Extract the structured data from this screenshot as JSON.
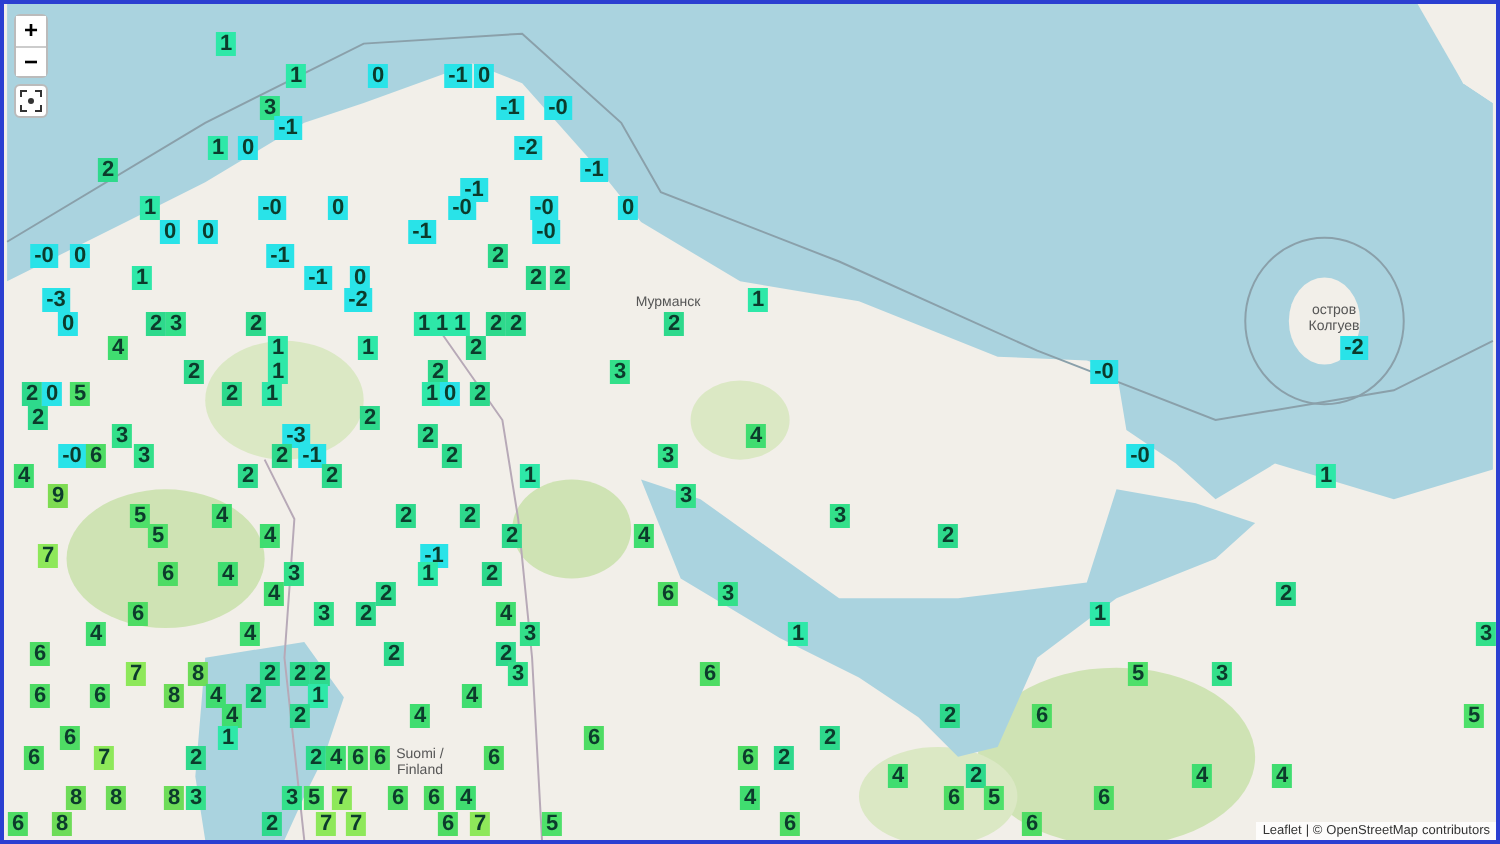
{
  "map": {
    "controls": {
      "zoom_in": "+",
      "zoom_out": "−"
    },
    "place_labels": [
      "Мурманск",
      "остров Колгуев",
      "Suomi / Finland"
    ],
    "markers": [
      {
        "value": "1",
        "color": "#2ee8a8"
      },
      {
        "value": "1",
        "color": "#2ee8a8"
      },
      {
        "value": "0",
        "color": "#29e3e8"
      },
      {
        "value": "-1",
        "color": "#29e3e8"
      },
      {
        "value": "0",
        "color": "#29e3e8"
      },
      {
        "value": "3",
        "color": "#33e08a"
      },
      {
        "value": "-1",
        "color": "#29e3e8"
      },
      {
        "value": "-0",
        "color": "#29e3e8"
      },
      {
        "value": "-1",
        "color": "#29e3e8"
      },
      {
        "value": "1",
        "color": "#2ee8a8"
      },
      {
        "value": "0",
        "color": "#29e3e8"
      },
      {
        "value": "-2",
        "color": "#29e3e8"
      },
      {
        "value": "2",
        "color": "#2ed98c"
      },
      {
        "value": "-1",
        "color": "#29e3e8"
      },
      {
        "value": "-1",
        "color": "#29e3e8"
      },
      {
        "value": "1",
        "color": "#2ee8a8"
      },
      {
        "value": "-0",
        "color": "#29e3e8"
      },
      {
        "value": "0",
        "color": "#29e3e8"
      },
      {
        "value": "-0",
        "color": "#29e3e8"
      },
      {
        "value": "-0",
        "color": "#29e3e8"
      },
      {
        "value": "0",
        "color": "#29e3e8"
      },
      {
        "value": "0",
        "color": "#29e3e8"
      },
      {
        "value": "0",
        "color": "#29e3e8"
      },
      {
        "value": "-1",
        "color": "#29e3e8"
      },
      {
        "value": "-0",
        "color": "#29e3e8"
      },
      {
        "value": "-0",
        "color": "#29e3e8"
      },
      {
        "value": "0",
        "color": "#29e3e8"
      },
      {
        "value": "-1",
        "color": "#29e3e8"
      },
      {
        "value": "2",
        "color": "#2ed98c"
      },
      {
        "value": "1",
        "color": "#2ee8a8"
      },
      {
        "value": "-1",
        "color": "#29e3e8"
      },
      {
        "value": "0",
        "color": "#29e3e8"
      },
      {
        "value": "2",
        "color": "#2ed98c"
      },
      {
        "value": "2",
        "color": "#2ed98c"
      },
      {
        "value": "-3",
        "color": "#29e3e8"
      },
      {
        "value": "-2",
        "color": "#29e3e8"
      },
      {
        "value": "1",
        "color": "#2ee8a8"
      },
      {
        "value": "0",
        "color": "#29e3e8"
      },
      {
        "value": "2",
        "color": "#2ed98c"
      },
      {
        "value": "3",
        "color": "#33e08a"
      },
      {
        "value": "2",
        "color": "#2ed98c"
      },
      {
        "value": "1",
        "color": "#2ee8a8"
      },
      {
        "value": "1",
        "color": "#2ee8a8"
      },
      {
        "value": "1",
        "color": "#2ee8a8"
      },
      {
        "value": "2",
        "color": "#2ed98c"
      },
      {
        "value": "2",
        "color": "#2ed98c"
      },
      {
        "value": "2",
        "color": "#2ed98c"
      },
      {
        "value": "4",
        "color": "#40dd70"
      },
      {
        "value": "1",
        "color": "#2ee8a8"
      },
      {
        "value": "1",
        "color": "#2ee8a8"
      },
      {
        "value": "2",
        "color": "#2ed98c"
      },
      {
        "value": "-2",
        "color": "#29e3e8"
      },
      {
        "value": "2",
        "color": "#2ed98c"
      },
      {
        "value": "1",
        "color": "#2ee8a8"
      },
      {
        "value": "2",
        "color": "#2ed98c"
      },
      {
        "value": "3",
        "color": "#33e08a"
      },
      {
        "value": "-0",
        "color": "#29e3e8"
      },
      {
        "value": "2",
        "color": "#2ed98c"
      },
      {
        "value": "0",
        "color": "#29e3e8"
      },
      {
        "value": "5",
        "color": "#4ee06a"
      },
      {
        "value": "2",
        "color": "#2ed98c"
      },
      {
        "value": "1",
        "color": "#2ee8a8"
      },
      {
        "value": "1",
        "color": "#2ee8a8"
      },
      {
        "value": "0",
        "color": "#29e3e8"
      },
      {
        "value": "2",
        "color": "#2ed98c"
      },
      {
        "value": "2",
        "color": "#2ed98c"
      },
      {
        "value": "2",
        "color": "#2ed98c"
      },
      {
        "value": "3",
        "color": "#33e08a"
      },
      {
        "value": "-3",
        "color": "#29e3e8"
      },
      {
        "value": "2",
        "color": "#2ed98c"
      },
      {
        "value": "4",
        "color": "#40dd70"
      },
      {
        "value": "-0",
        "color": "#29e3e8"
      },
      {
        "value": "6",
        "color": "#4edc64"
      },
      {
        "value": "3",
        "color": "#33e08a"
      },
      {
        "value": "2",
        "color": "#2ed98c"
      },
      {
        "value": "-1",
        "color": "#29e3e8"
      },
      {
        "value": "2",
        "color": "#2ed98c"
      },
      {
        "value": "3",
        "color": "#33e08a"
      },
      {
        "value": "-0",
        "color": "#29e3e8"
      },
      {
        "value": "4",
        "color": "#40dd70"
      },
      {
        "value": "2",
        "color": "#2ed98c"
      },
      {
        "value": "2",
        "color": "#2ed98c"
      },
      {
        "value": "1",
        "color": "#2ee8a8"
      },
      {
        "value": "1",
        "color": "#2ee8a8"
      },
      {
        "value": "9",
        "color": "#7edc52"
      },
      {
        "value": "3",
        "color": "#33e08a"
      },
      {
        "value": "5",
        "color": "#4ee06a"
      },
      {
        "value": "4",
        "color": "#40dd70"
      },
      {
        "value": "2",
        "color": "#2ed98c"
      },
      {
        "value": "2",
        "color": "#2ed98c"
      },
      {
        "value": "3",
        "color": "#33e08a"
      },
      {
        "value": "5",
        "color": "#4ee06a"
      },
      {
        "value": "4",
        "color": "#40dd70"
      },
      {
        "value": "2",
        "color": "#2ed98c"
      },
      {
        "value": "4",
        "color": "#40dd70"
      },
      {
        "value": "2",
        "color": "#2ed98c"
      },
      {
        "value": "7",
        "color": "#8ee85a"
      },
      {
        "value": "-1",
        "color": "#29e3e8"
      },
      {
        "value": "6",
        "color": "#4edc64"
      },
      {
        "value": "4",
        "color": "#40dd70"
      },
      {
        "value": "3",
        "color": "#33e08a"
      },
      {
        "value": "1",
        "color": "#2ee8a8"
      },
      {
        "value": "2",
        "color": "#2ed98c"
      },
      {
        "value": "4",
        "color": "#40dd70"
      },
      {
        "value": "2",
        "color": "#2ed98c"
      },
      {
        "value": "6",
        "color": "#4edc64"
      },
      {
        "value": "3",
        "color": "#33e08a"
      },
      {
        "value": "2",
        "color": "#2ed98c"
      },
      {
        "value": "6",
        "color": "#4edc64"
      },
      {
        "value": "3",
        "color": "#33e08a"
      },
      {
        "value": "2",
        "color": "#2ed98c"
      },
      {
        "value": "4",
        "color": "#40dd70"
      },
      {
        "value": "1",
        "color": "#2ee8a8"
      },
      {
        "value": "4",
        "color": "#40dd70"
      },
      {
        "value": "4",
        "color": "#40dd70"
      },
      {
        "value": "3",
        "color": "#33e08a"
      },
      {
        "value": "1",
        "color": "#2ee8a8"
      },
      {
        "value": "3",
        "color": "#33e08a"
      },
      {
        "value": "6",
        "color": "#4edc64"
      },
      {
        "value": "2",
        "color": "#2ed98c"
      },
      {
        "value": "2",
        "color": "#2ed98c"
      },
      {
        "value": "7",
        "color": "#8ee85a"
      },
      {
        "value": "8",
        "color": "#6edc58"
      },
      {
        "value": "2",
        "color": "#2ed98c"
      },
      {
        "value": "2",
        "color": "#2ed98c"
      },
      {
        "value": "2",
        "color": "#2ed98c"
      },
      {
        "value": "3",
        "color": "#33e08a"
      },
      {
        "value": "6",
        "color": "#4edc64"
      },
      {
        "value": "5",
        "color": "#4ee06a"
      },
      {
        "value": "3",
        "color": "#33e08a"
      },
      {
        "value": "6",
        "color": "#4edc64"
      },
      {
        "value": "6",
        "color": "#4edc64"
      },
      {
        "value": "8",
        "color": "#6edc58"
      },
      {
        "value": "4",
        "color": "#40dd70"
      },
      {
        "value": "2",
        "color": "#2ed98c"
      },
      {
        "value": "1",
        "color": "#2ee8a8"
      },
      {
        "value": "4",
        "color": "#40dd70"
      },
      {
        "value": "4",
        "color": "#40dd70"
      },
      {
        "value": "2",
        "color": "#2ed98c"
      },
      {
        "value": "4",
        "color": "#40dd70"
      },
      {
        "value": "2",
        "color": "#2ed98c"
      },
      {
        "value": "6",
        "color": "#4edc64"
      },
      {
        "value": "5",
        "color": "#4ee06a"
      },
      {
        "value": "6",
        "color": "#4edc64"
      },
      {
        "value": "1",
        "color": "#2ee8a8"
      },
      {
        "value": "6",
        "color": "#4edc64"
      },
      {
        "value": "2",
        "color": "#2ed98c"
      },
      {
        "value": "6",
        "color": "#4edc64"
      },
      {
        "value": "7",
        "color": "#8ee85a"
      },
      {
        "value": "2",
        "color": "#2ed98c"
      },
      {
        "value": "2",
        "color": "#2ed98c"
      },
      {
        "value": "4",
        "color": "#40dd70"
      },
      {
        "value": "6",
        "color": "#4edc64"
      },
      {
        "value": "6",
        "color": "#4edc64"
      },
      {
        "value": "6",
        "color": "#4edc64"
      },
      {
        "value": "6",
        "color": "#4edc64"
      },
      {
        "value": "2",
        "color": "#2ed98c"
      },
      {
        "value": "4",
        "color": "#40dd70"
      },
      {
        "value": "2",
        "color": "#2ed98c"
      },
      {
        "value": "4",
        "color": "#40dd70"
      },
      {
        "value": "4",
        "color": "#40dd70"
      },
      {
        "value": "8",
        "color": "#6edc58"
      },
      {
        "value": "8",
        "color": "#6edc58"
      },
      {
        "value": "8",
        "color": "#6edc58"
      },
      {
        "value": "3",
        "color": "#33e08a"
      },
      {
        "value": "3",
        "color": "#33e08a"
      },
      {
        "value": "5",
        "color": "#4ee06a"
      },
      {
        "value": "7",
        "color": "#8ee85a"
      },
      {
        "value": "6",
        "color": "#4edc64"
      },
      {
        "value": "6",
        "color": "#4edc64"
      },
      {
        "value": "4",
        "color": "#40dd70"
      },
      {
        "value": "4",
        "color": "#40dd70"
      },
      {
        "value": "6",
        "color": "#4edc64"
      },
      {
        "value": "5",
        "color": "#4ee06a"
      },
      {
        "value": "6",
        "color": "#4edc64"
      },
      {
        "value": "6",
        "color": "#4edc64"
      },
      {
        "value": "8",
        "color": "#6edc58"
      },
      {
        "value": "2",
        "color": "#2ed98c"
      },
      {
        "value": "7",
        "color": "#8ee85a"
      },
      {
        "value": "7",
        "color": "#8ee85a"
      },
      {
        "value": "6",
        "color": "#4edc64"
      },
      {
        "value": "7",
        "color": "#8ee85a"
      },
      {
        "value": "5",
        "color": "#4ee06a"
      },
      {
        "value": "6",
        "color": "#4edc64"
      },
      {
        "value": "6",
        "color": "#4edc64"
      }
    ]
  },
  "attribution": {
    "link_1": "Leaflet",
    "text_1": "| ©",
    "link_2": "OpenStreetMap",
    "text_2": "contributors"
  }
}
